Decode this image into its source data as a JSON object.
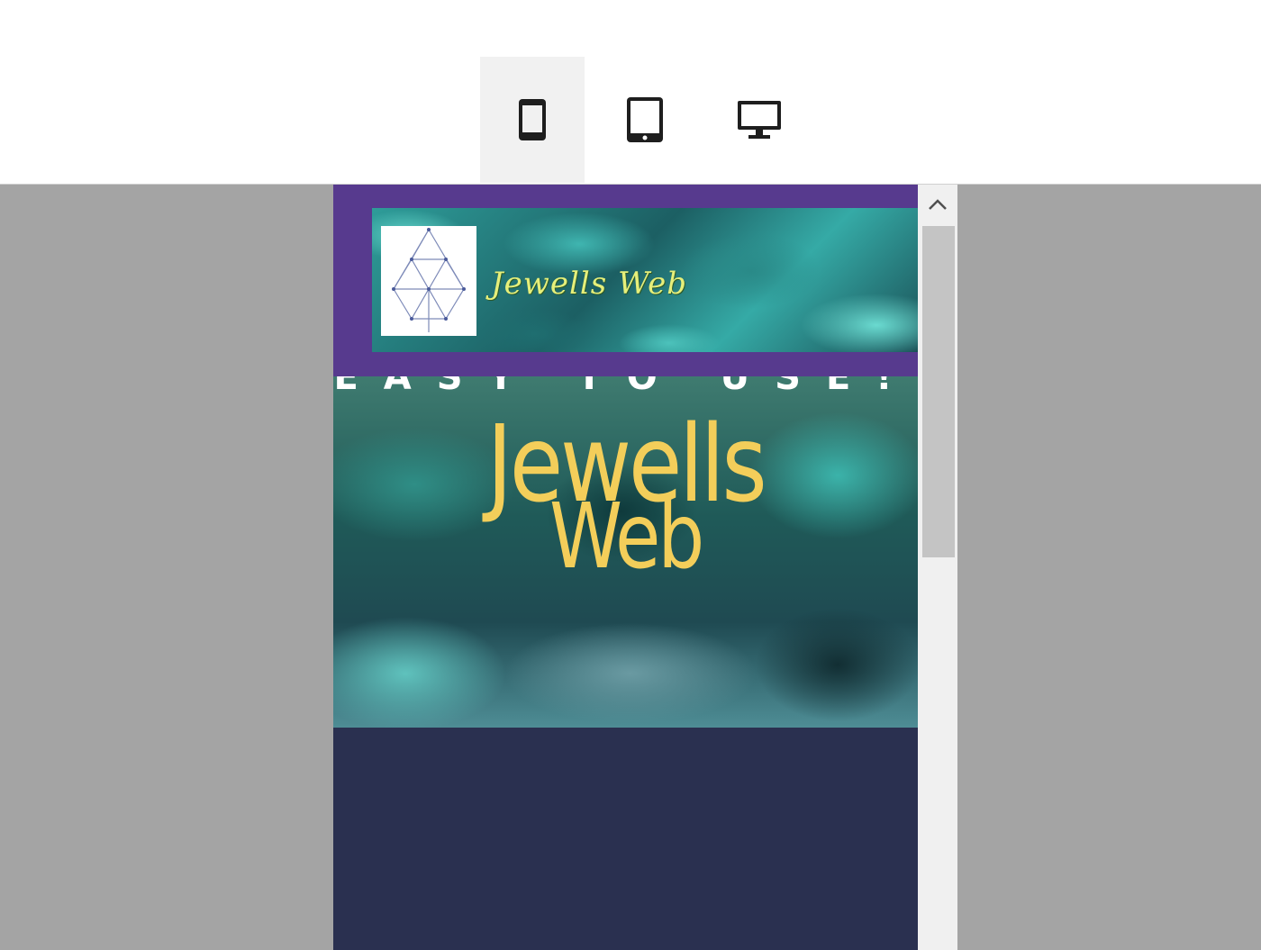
{
  "toolbar": {
    "devices": [
      {
        "id": "mobile",
        "icon": "mobile-phone-icon",
        "active": true
      },
      {
        "id": "tablet",
        "icon": "tablet-icon",
        "active": false
      },
      {
        "id": "desktop",
        "icon": "desktop-monitor-icon",
        "active": false
      }
    ]
  },
  "preview": {
    "banner_title": "Jewells Web",
    "hero_tagline": "EASY TO USE!",
    "hero_title": "Jewells",
    "hero_subtitle": "Web"
  },
  "colors": {
    "toolbar_bg": "#ffffff",
    "page_bg": "#a4a4a4",
    "header_band": "#573a8e",
    "hero_text": "#f3ce5a",
    "footer_bg": "#2a3050",
    "banner_text": "#e6ef7a"
  }
}
